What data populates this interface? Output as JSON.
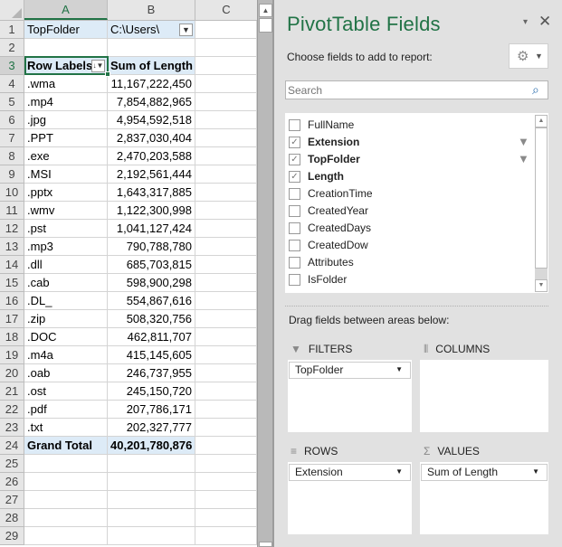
{
  "sheet": {
    "columns": [
      "A",
      "B",
      "C"
    ],
    "selected_column": "A",
    "selected_row": "3",
    "row_numbers": [
      "1",
      "2",
      "3",
      "4",
      "5",
      "6",
      "7",
      "8",
      "9",
      "10",
      "11",
      "12",
      "13",
      "14",
      "15",
      "16",
      "17",
      "18",
      "19",
      "20",
      "21",
      "22",
      "23",
      "24",
      "25",
      "26",
      "27",
      "28",
      "29"
    ],
    "filter_row": {
      "label": "TopFolder",
      "value": "C:\\Users\\"
    },
    "header_row": {
      "row_labels": "Row Labels",
      "sum_label": "Sum of Length"
    },
    "rows": [
      {
        "ext": ".wma",
        "value": "11,167,222,450"
      },
      {
        "ext": ".mp4",
        "value": "7,854,882,965"
      },
      {
        "ext": ".jpg",
        "value": "4,954,592,518"
      },
      {
        "ext": ".PPT",
        "value": "2,837,030,404"
      },
      {
        "ext": ".exe",
        "value": "2,470,203,588"
      },
      {
        "ext": ".MSI",
        "value": "2,192,561,444"
      },
      {
        "ext": ".pptx",
        "value": "1,643,317,885"
      },
      {
        "ext": ".wmv",
        "value": "1,122,300,998"
      },
      {
        "ext": ".pst",
        "value": "1,041,127,424"
      },
      {
        "ext": ".mp3",
        "value": "790,788,780"
      },
      {
        "ext": ".dll",
        "value": "685,703,815"
      },
      {
        "ext": ".cab",
        "value": "598,900,298"
      },
      {
        "ext": ".DL_",
        "value": "554,867,616"
      },
      {
        "ext": ".zip",
        "value": "508,320,756"
      },
      {
        "ext": ".DOC",
        "value": "462,811,707"
      },
      {
        "ext": ".m4a",
        "value": "415,145,605"
      },
      {
        "ext": ".oab",
        "value": "246,737,955"
      },
      {
        "ext": ".ost",
        "value": "245,150,720"
      },
      {
        "ext": ".pdf",
        "value": "207,786,171"
      },
      {
        "ext": ".txt",
        "value": "202,327,777"
      }
    ],
    "grand_total": {
      "label": "Grand Total",
      "value": "40,201,780,876"
    }
  },
  "panel": {
    "title": "PivotTable Fields",
    "menu_icon": "▾",
    "close_icon": "✕",
    "choose_label": "Choose fields to add to report:",
    "search_placeholder": "Search",
    "fields": [
      {
        "name": "FullName",
        "checked": false,
        "filtered": false
      },
      {
        "name": "Extension",
        "checked": true,
        "filtered": true
      },
      {
        "name": "TopFolder",
        "checked": true,
        "filtered": true
      },
      {
        "name": "Length",
        "checked": true,
        "filtered": false
      },
      {
        "name": "CreationTime",
        "checked": false,
        "filtered": false
      },
      {
        "name": "CreatedYear",
        "checked": false,
        "filtered": false
      },
      {
        "name": "CreatedDays",
        "checked": false,
        "filtered": false
      },
      {
        "name": "CreatedDow",
        "checked": false,
        "filtered": false
      },
      {
        "name": "Attributes",
        "checked": false,
        "filtered": false
      },
      {
        "name": "IsFolder",
        "checked": false,
        "filtered": false
      }
    ],
    "drag_label": "Drag fields between areas below:",
    "areas": {
      "filters": {
        "label": "FILTERS",
        "items": [
          "TopFolder"
        ]
      },
      "columns": {
        "label": "COLUMNS",
        "items": []
      },
      "rows": {
        "label": "ROWS",
        "items": [
          "Extension"
        ]
      },
      "values": {
        "label": "VALUES",
        "items": [
          "Sum of Length"
        ]
      }
    }
  },
  "colors": {
    "accent": "#217346",
    "pivot_header_fill": "#ddebf7",
    "panel_bg": "#e1e1e1"
  }
}
